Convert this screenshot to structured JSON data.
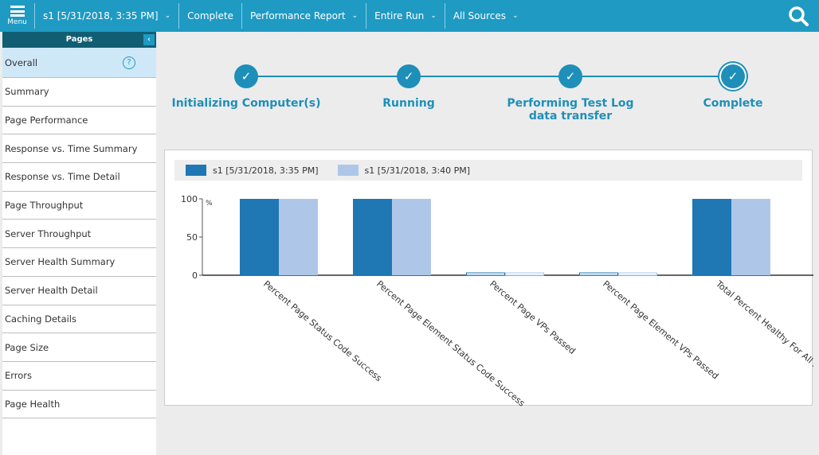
{
  "toolbar": {
    "menu_label": "Menu",
    "run": "s1 [5/31/2018, 3:35 PM]",
    "status": "Complete",
    "report": "Performance Report",
    "range": "Entire Run",
    "sources": "All Sources",
    "search_icon": "search-icon"
  },
  "sidebar": {
    "title": "Pages",
    "items": [
      {
        "label": "Overall"
      },
      {
        "label": "Summary"
      },
      {
        "label": "Page Performance"
      },
      {
        "label": "Response vs. Time Summary"
      },
      {
        "label": "Response vs. Time Detail"
      },
      {
        "label": "Page Throughput"
      },
      {
        "label": "Server Throughput"
      },
      {
        "label": "Server Health Summary"
      },
      {
        "label": "Server Health Detail"
      },
      {
        "label": "Caching Details"
      },
      {
        "label": "Page Size"
      },
      {
        "label": "Errors"
      },
      {
        "label": "Page Health"
      }
    ],
    "selected": "Overall"
  },
  "progress": {
    "steps": [
      {
        "label": "Initializing Computer(s)"
      },
      {
        "label": "Running"
      },
      {
        "label": "Performing Test Log data transfer"
      },
      {
        "label": "Complete"
      }
    ],
    "current": "Complete",
    "color": "#1e8fb8"
  },
  "chart_data": {
    "type": "bar",
    "categories": [
      "Percent Page Status Code Success",
      "Percent Page Element Status Code Success",
      "Percent Page VPs Passed",
      "Percent Page Element VPs Passed",
      "Total Percent Healthy For All Pag"
    ],
    "series": [
      {
        "name": "s1 [5/31/2018, 3:35 PM]",
        "color": "#1f77b4",
        "values": [
          100,
          100,
          0,
          0,
          100
        ]
      },
      {
        "name": "s1 [5/31/2018, 3:40 PM]",
        "color": "#aec7e8",
        "values": [
          100,
          100,
          0,
          0,
          100
        ]
      }
    ],
    "yticks": [
      "0",
      "50",
      "100"
    ],
    "yunit": "%",
    "ylim": [
      0,
      100
    ],
    "legend": "top-left",
    "grid": false
  }
}
